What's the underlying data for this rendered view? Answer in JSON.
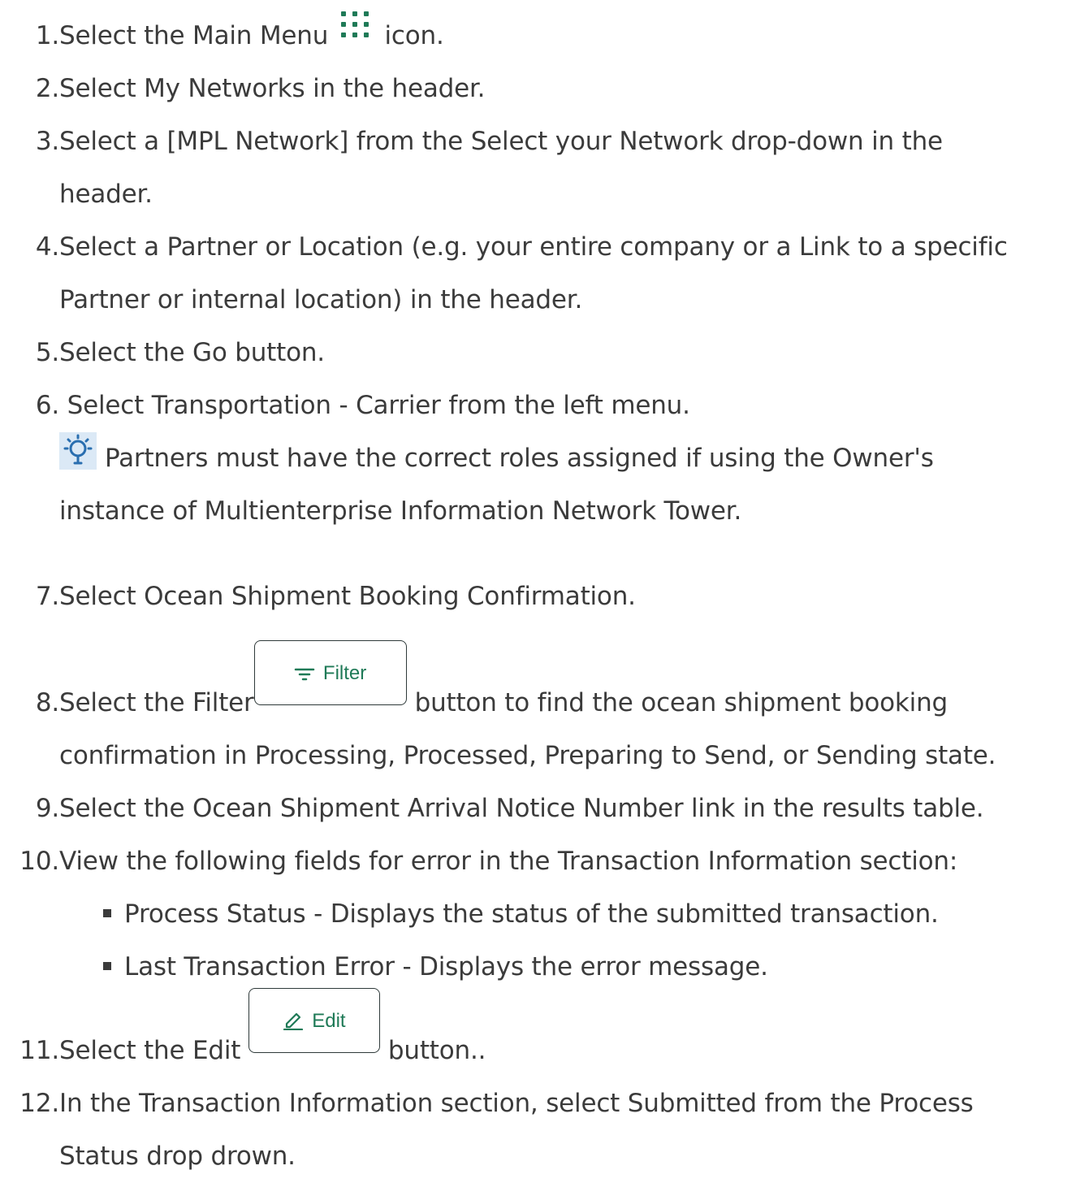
{
  "steps": [
    {
      "num": "1.",
      "before": "Select the Main Menu ",
      "after": " icon."
    },
    {
      "num": "2.",
      "text": "Select My Networks in the header."
    },
    {
      "num": "3.",
      "line1": "Select a [MPL Network] from the Select your Network drop-down in the",
      "line2": "header."
    },
    {
      "num": "4.",
      "line1": "Select a Partner or Location (e.g. your entire company or a Link to a specific",
      "line2": "Partner or internal location) in the header."
    },
    {
      "num": "5.",
      "text": "Select the Go button."
    },
    {
      "num": "6.",
      "text": " Select Transportation - Carrier from the left menu."
    },
    {
      "num": "7.",
      "text": "Select Ocean Shipment Booking Confirmation."
    },
    {
      "num": "8.",
      "before": "Select the Filter",
      "after": "button to find the ocean shipment booking",
      "line2": "confirmation in Processing, Processed, Preparing to Send, or Sending state."
    },
    {
      "num": "9.",
      "text": "Select the Ocean Shipment Arrival Notice Number link in the results table."
    },
    {
      "num": "10.",
      "text": "View the following fields for error in the Transaction Information section:"
    },
    {
      "num": "11.",
      "before": "Select the Edit ",
      "after": "button.."
    },
    {
      "num": "12.",
      "line1": "In the Transaction Information section, select Submitted from the Process",
      "line2": "Status drop drown."
    }
  ],
  "tip": {
    "icon": "lightbulb-icon",
    "line1": "Partners must have the correct roles assigned if using the Owner's",
    "line2": "instance of Multienterprise Information Network Tower."
  },
  "sub_items": [
    "Process Status - Displays the status of the submitted transaction.",
    "Last Transaction Error - Displays the error message."
  ],
  "buttons": {
    "filter_label": "Filter",
    "edit_label": "Edit"
  },
  "icons": {
    "main_menu": "grid-menu-icon",
    "filter": "filter-icon",
    "edit": "pencil-icon"
  },
  "colors": {
    "accent_green": "#1f7a57",
    "tip_blue": "#2a6fb0",
    "tip_bg": "#dbe9f6"
  }
}
